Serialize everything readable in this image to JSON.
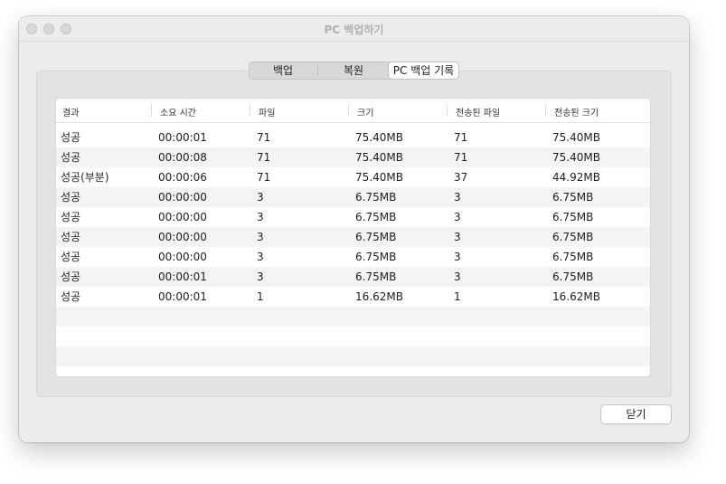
{
  "window": {
    "title": "PC 백업하기"
  },
  "tabs": [
    {
      "label": "백업",
      "selected": false
    },
    {
      "label": "복원",
      "selected": false
    },
    {
      "label": "PC 백업 기록",
      "selected": true
    }
  ],
  "table": {
    "columns": [
      "결과",
      "소요 시간",
      "파일",
      "크기",
      "전송된 파일",
      "전송된 크기"
    ],
    "rows": [
      [
        "성공",
        "00:00:01",
        "71",
        "75.40MB",
        "71",
        "75.40MB"
      ],
      [
        "성공",
        "00:00:08",
        "71",
        "75.40MB",
        "71",
        "75.40MB"
      ],
      [
        "성공(부분)",
        "00:00:06",
        "71",
        "75.40MB",
        "37",
        "44.92MB"
      ],
      [
        "성공",
        "00:00:00",
        "3",
        "6.75MB",
        "3",
        "6.75MB"
      ],
      [
        "성공",
        "00:00:00",
        "3",
        "6.75MB",
        "3",
        "6.75MB"
      ],
      [
        "성공",
        "00:00:00",
        "3",
        "6.75MB",
        "3",
        "6.75MB"
      ],
      [
        "성공",
        "00:00:00",
        "3",
        "6.75MB",
        "3",
        "6.75MB"
      ],
      [
        "성공",
        "00:00:01",
        "3",
        "6.75MB",
        "3",
        "6.75MB"
      ],
      [
        "성공",
        "00:00:01",
        "1",
        "16.62MB",
        "1",
        "16.62MB"
      ]
    ]
  },
  "footer": {
    "close_label": "닫기"
  },
  "colors": {
    "row_alt": "#f2f4f5",
    "window_bg": "#ececec"
  }
}
